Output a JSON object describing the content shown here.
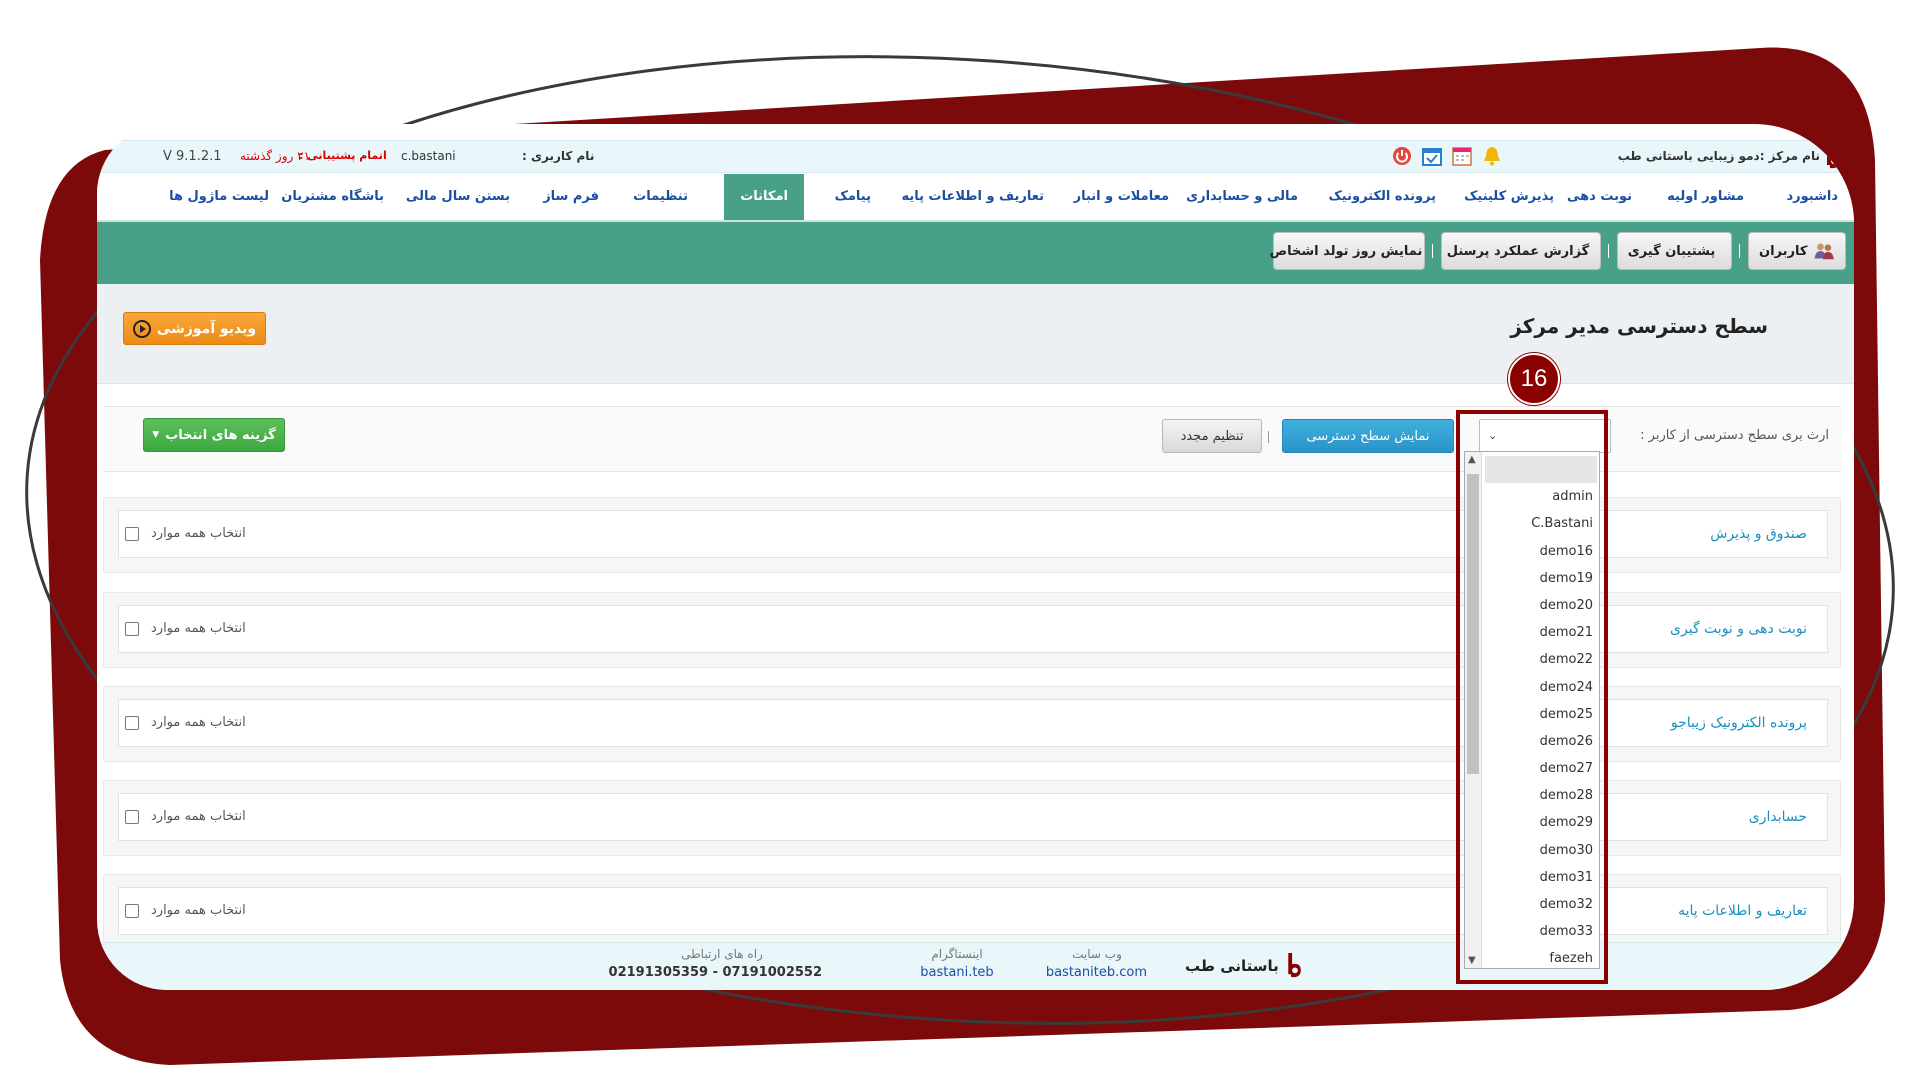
{
  "topbar": {
    "center_label": "نام مرکز :",
    "center_name": "دمو زیبایی باستانی طب",
    "username_label": "نام کاربری :",
    "username": "c.bastani",
    "support_label": "اتمام پشتیبانی :",
    "support_value": "۲۱ روز گذشته",
    "version": "V 9.1.2.1",
    "icons": [
      "bell-icon",
      "calendar-icon",
      "calendar-check-icon",
      "power-icon"
    ]
  },
  "nav": {
    "items": [
      "داشبورد",
      "مشاور اولیه",
      "نوبت دهی",
      "پذیرش کلینیک",
      "پرونده الکترونیک",
      "مالی و حسابداری",
      "معاملات و انبار",
      "تعاریف و اطلاعات پایه",
      "پیامک",
      "امکانات",
      "تنظیمات",
      "فرم ساز",
      "بستن سال مالی",
      "باشگاه مشتریان",
      "لیست ماژول ها"
    ],
    "active": "امکانات"
  },
  "toolbar": {
    "users": "کاربران",
    "backup": "پشتیبان گیری",
    "report": "گزارش عملکرد پرسنل",
    "birthday": "نمایش روز تولد اشخاص"
  },
  "page": {
    "title": "سطح دسترسی مدیر مرکز",
    "video_button": "ویدیو آموزشی"
  },
  "filter": {
    "inherit_label": "ارث بری سطح دسترسی از کاربر :",
    "show_button": "نمایش سطح دسترسی",
    "reset_button": "تنظیم مجدد",
    "options_button": "گزینه های انتخاب"
  },
  "sections": [
    {
      "title": "صندوق و پذیرش",
      "select_all": "انتخاب همه موارد"
    },
    {
      "title": "نوبت دهی و نوبت گیری",
      "select_all": "انتخاب همه موارد"
    },
    {
      "title": "پرونده الکترونیک زیباجو",
      "select_all": "انتخاب همه موارد"
    },
    {
      "title": "حسابداری",
      "select_all": "انتخاب همه موارد"
    },
    {
      "title": "تعاریف و اطلاعات پایه",
      "select_all": "انتخاب همه موارد"
    }
  ],
  "dropdown": {
    "options": [
      "",
      "admin",
      "C.Bastani",
      "demo16",
      "demo19",
      "demo20",
      "demo21",
      "demo22",
      "demo24",
      "demo25",
      "demo26",
      "demo27",
      "demo28",
      "demo29",
      "demo30",
      "demo31",
      "demo32",
      "demo33",
      "faezeh"
    ]
  },
  "badge": "16",
  "footer": {
    "brand": "باستانی طب",
    "website_label": "وب سایت",
    "website": "bastaniteb.com",
    "instagram_label": "اینستاگرام",
    "instagram": "bastani.teb",
    "contact_label": "راه های ارتباطی",
    "contact": "07191002552 - 02191305359"
  },
  "colors": {
    "frame": "#8b0000",
    "toolbar": "#49a088",
    "nav_text": "#1a4fa3",
    "section_title": "#1a8fbf"
  }
}
